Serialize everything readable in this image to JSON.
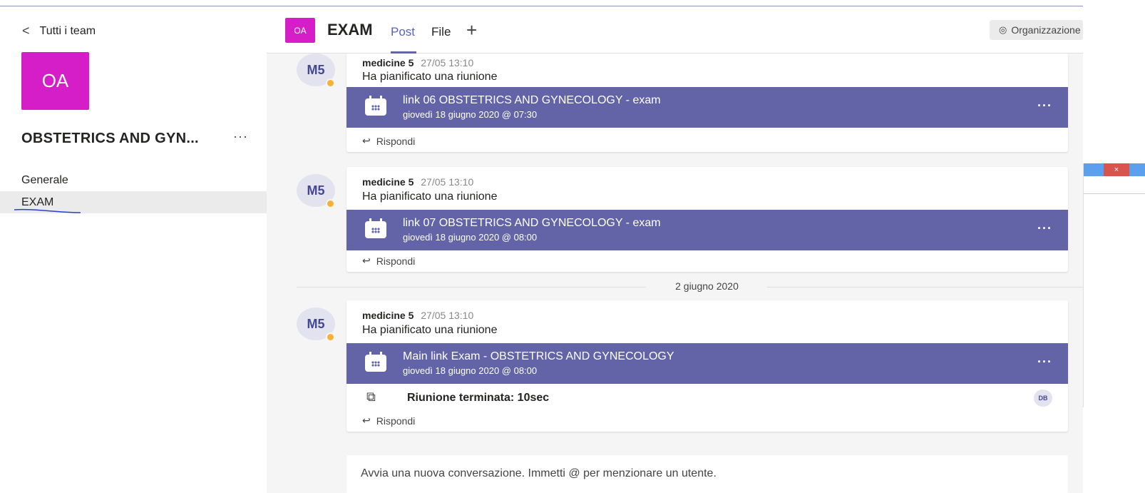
{
  "sidebar": {
    "back_label": "Tutti i team",
    "team_initials": "OA",
    "team_name": "OBSTETRICS AND GYN...",
    "more": "···",
    "channels": [
      {
        "label": "Generale"
      },
      {
        "label": "EXAM"
      }
    ]
  },
  "header": {
    "tile": "OA",
    "title": "EXAM",
    "tabs": [
      {
        "label": "Post"
      },
      {
        "label": "File"
      }
    ],
    "add": "+",
    "org_button": "Organizzazione"
  },
  "messages": [
    {
      "avatar": "M5",
      "author": "medicine 5",
      "time": "27/05 13:10",
      "text": "Ha pianificato una riunione",
      "meeting_title": "link 06 OBSTETRICS AND GYNECOLOGY - exam",
      "meeting_date": "giovedì 18 giugno 2020 @ 07:30",
      "reply": "Rispondi"
    },
    {
      "avatar": "M5",
      "author": "medicine 5",
      "time": "27/05 13:10",
      "text": "Ha pianificato una riunione",
      "meeting_title": "link 07 OBSTETRICS AND GYNECOLOGY - exam",
      "meeting_date": "giovedì 18 giugno 2020 @ 08:00",
      "reply": "Rispondi"
    },
    {
      "avatar": "M5",
      "author": "medicine 5",
      "time": "27/05 13:10",
      "text": "Ha pianificato una riunione",
      "meeting_title": "Main link Exam - OBSTETRICS AND GYNECOLOGY",
      "meeting_date": "giovedì 18 giugno 2020 @ 08:00",
      "ended": "Riunione terminata: 10sec",
      "participant": "DB",
      "reply": "Rispondi"
    }
  ],
  "date_separator": "2 giugno 2020",
  "compose_placeholder": "Avvia una nuova conversazione. Immetti @ per menzionare un utente.",
  "colors": {
    "accent": "#6264a7",
    "team_tile": "#d51ec8",
    "status": "#f8b133"
  },
  "icons": [
    "chevron-left-icon",
    "calendar-icon",
    "reply-arrow-icon",
    "video-icon",
    "eye-icon",
    "plus-icon"
  ]
}
